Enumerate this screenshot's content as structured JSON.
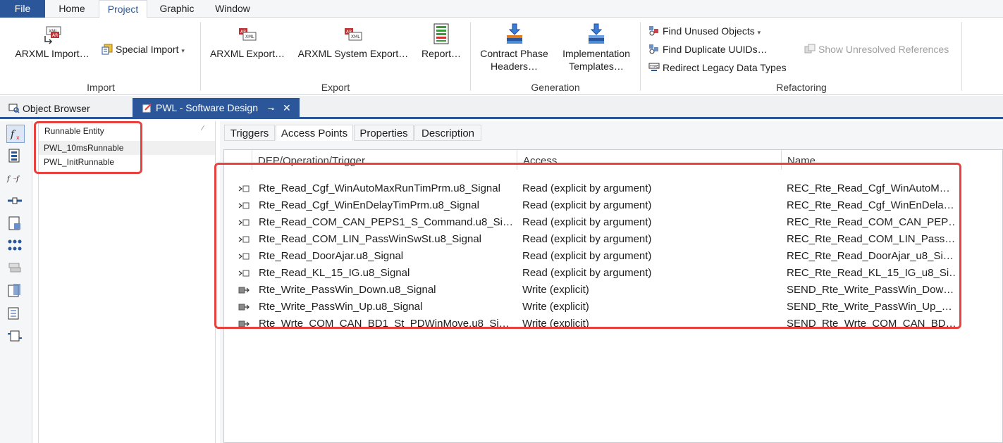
{
  "menu": {
    "file": "File",
    "home": "Home",
    "project": "Project",
    "graphic": "Graphic",
    "window": "Window"
  },
  "ribbon": {
    "import": {
      "label": "Import",
      "arxml_import": "ARXML Import…",
      "special_import": "Special Import"
    },
    "export": {
      "label": "Export",
      "arxml_export": "ARXML Export…",
      "arxml_system_export": "ARXML System Export…",
      "report": "Report…"
    },
    "generation": {
      "label": "Generation",
      "contract_phase_line1": "Contract Phase",
      "contract_phase_line2": "Headers…",
      "implementation_line1": "Implementation",
      "implementation_line2": "Templates…"
    },
    "refactoring": {
      "label": "Refactoring",
      "find_unused": "Find Unused Objects",
      "find_duplicate": "Find Duplicate UUIDs…",
      "redirect_legacy": "Redirect Legacy Data Types",
      "show_unresolved": "Show Unresolved References"
    }
  },
  "doc_tabs": {
    "object_browser": "Object Browser",
    "pwl": "PWL - Software Design"
  },
  "runnables": {
    "header": "Runnable Entity",
    "items": [
      "PWL_10msRunnable",
      "PWL_InitRunnable"
    ]
  },
  "sub_tabs": [
    "Triggers",
    "Access Points",
    "Properties",
    "Description"
  ],
  "grid": {
    "columns": [
      "DEP/Operation/Trigger",
      "Access",
      "Name"
    ],
    "rows": [
      {
        "dep": "Rte_Read_Cgf_WinAutoMaxRunTimPrm.u8_Signal",
        "access": "Read (explicit by argument)",
        "name": "REC_Rte_Read_Cgf_WinAutoM…",
        "kind": "read"
      },
      {
        "dep": "Rte_Read_Cgf_WinEnDelayTimPrm.u8_Signal",
        "access": "Read (explicit by argument)",
        "name": "REC_Rte_Read_Cgf_WinEnDela…",
        "kind": "read"
      },
      {
        "dep": "Rte_Read_COM_CAN_PEPS1_S_Command.u8_Si…",
        "access": "Read (explicit by argument)",
        "name": "REC_Rte_Read_COM_CAN_PEP…",
        "kind": "read"
      },
      {
        "dep": "Rte_Read_COM_LIN_PassWinSwSt.u8_Signal",
        "access": "Read (explicit by argument)",
        "name": "REC_Rte_Read_COM_LIN_Pass…",
        "kind": "read"
      },
      {
        "dep": "Rte_Read_DoorAjar.u8_Signal",
        "access": "Read (explicit by argument)",
        "name": "REC_Rte_Read_DoorAjar_u8_Si…",
        "kind": "read"
      },
      {
        "dep": "Rte_Read_KL_15_IG.u8_Signal",
        "access": "Read (explicit by argument)",
        "name": "REC_Rte_Read_KL_15_IG_u8_Si…",
        "kind": "read"
      },
      {
        "dep": "Rte_Write_PassWin_Down.u8_Signal",
        "access": "Write (explicit)",
        "name": "SEND_Rte_Write_PassWin_Dow…",
        "kind": "write"
      },
      {
        "dep": "Rte_Write_PassWin_Up.u8_Signal",
        "access": "Write (explicit)",
        "name": "SEND_Rte_Write_PassWin_Up_…",
        "kind": "write"
      },
      {
        "dep": "Rte_Wrte_COM_CAN_BD1_St_PDWinMove.u8_Si…",
        "access": "Write (explicit)",
        "name": "SEND_Rte_Wrte_COM_CAN_BD…",
        "kind": "write"
      }
    ]
  },
  "colors": {
    "accent": "#2b579a",
    "highlight": "#e8423f"
  }
}
